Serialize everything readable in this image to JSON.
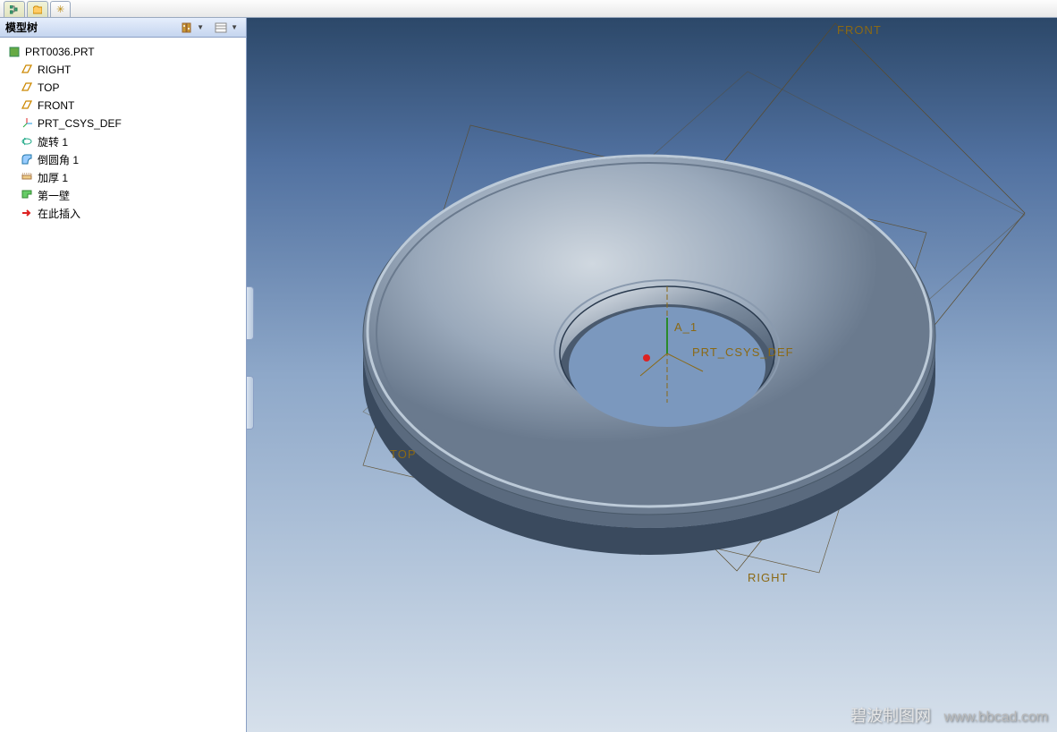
{
  "tabs": {
    "icons": [
      "tree-icon",
      "folder-icon"
    ],
    "new_tab_glyph": "✳"
  },
  "panel": {
    "title": "模型树",
    "tool1": "settings-icon",
    "tool2": "show-icon"
  },
  "tree": {
    "root": "PRT0036.PRT",
    "items": [
      {
        "icon": "datum-plane",
        "label": "RIGHT"
      },
      {
        "icon": "datum-plane",
        "label": "TOP"
      },
      {
        "icon": "datum-plane",
        "label": "FRONT"
      },
      {
        "icon": "csys",
        "label": "PRT_CSYS_DEF"
      },
      {
        "icon": "revolve",
        "label": "旋转 1"
      },
      {
        "icon": "round",
        "label": "倒圆角 1"
      },
      {
        "icon": "thicken",
        "label": "加厚 1"
      },
      {
        "icon": "wall",
        "label": "第一壁"
      },
      {
        "icon": "insert",
        "label": "在此插入"
      }
    ]
  },
  "viewport": {
    "labels": {
      "front": "FRONT",
      "right": "RIGHT",
      "top": "TOP",
      "axis": "A_1",
      "csys": "PRT_CSYS_DEF"
    }
  },
  "watermark": {
    "text": "碧波制图网",
    "url": "www.bbcad.com"
  }
}
